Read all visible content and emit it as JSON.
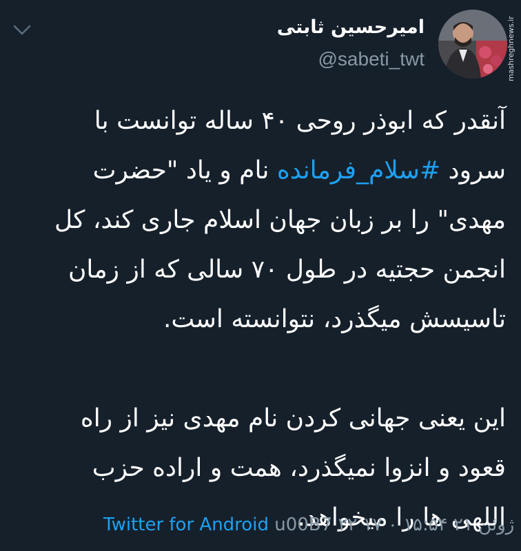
{
  "user": {
    "display_name": "امیرحسین ثابتی",
    "handle": "@sabeti_twt"
  },
  "watermark": "mashreghnews.ir",
  "tweet": {
    "lines_p1": [
      "آنقدر که ابوذر روحی ۴۰ ساله توانست با",
      "مهدی\" را بر زبان جهان اسلام جاری کند، کل",
      "انجمن حجتیه در طول ۷۰ سالی که از زمان",
      "تاسیسش میگذرد، نتوانسته است."
    ],
    "line2_prefix": "سرود ",
    "hashtag": "#سلام_فرمانده",
    "line2_suffix": " نام و یاد \"حضرت",
    "lines_p2": [
      "این یعنی جهانی کردن نام مهدی نیز از راه",
      "قعود و انزوا نمیگذرد، همت و اراده حزب",
      "اللهی ها را میخواهد."
    ]
  },
  "footer": {
    "client": "Twitter for Android",
    "separator": " u00B7 ",
    "date": "۲۲ ژوئن ۲۱",
    "time": "۱۵:۵۴ ۰ ۱۷"
  },
  "icons": {
    "chevron": "chevron-down-icon",
    "avatar": "avatar-photo"
  },
  "colors": {
    "background": "#16202b",
    "text": "#ffffff",
    "secondary": "#8899a6",
    "accent": "#1da1f2"
  }
}
